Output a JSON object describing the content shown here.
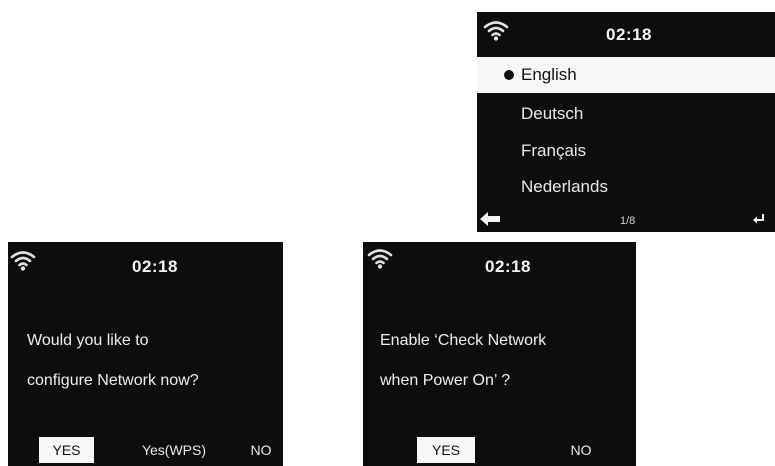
{
  "language_screen": {
    "time": "02:18",
    "languages": [
      "English",
      "Deutsch",
      "Français",
      "Nederlands"
    ],
    "selected_index": 0,
    "page_indicator": "1/8",
    "icons": {
      "wifi": "wifi-signal-icon",
      "back": "back-arrow-icon",
      "enter": "enter-return-icon"
    }
  },
  "network_screen": {
    "time": "02:18",
    "question_line1": "Would you like to",
    "question_line2": "configure Network now?",
    "options": [
      "YES",
      "Yes(WPS)",
      "NO"
    ],
    "selected_option": "YES"
  },
  "check_screen": {
    "time": "02:18",
    "question_line1": "Enable ‘Check Network",
    "question_line2": "when Power On’ ?",
    "options": [
      "YES",
      "NO"
    ],
    "selected_option": "YES"
  },
  "colors": {
    "screen_bg": "#0d0d0d",
    "text": "#f2f2f2",
    "highlight_bg": "#f7f7f7",
    "highlight_text": "#111111"
  }
}
